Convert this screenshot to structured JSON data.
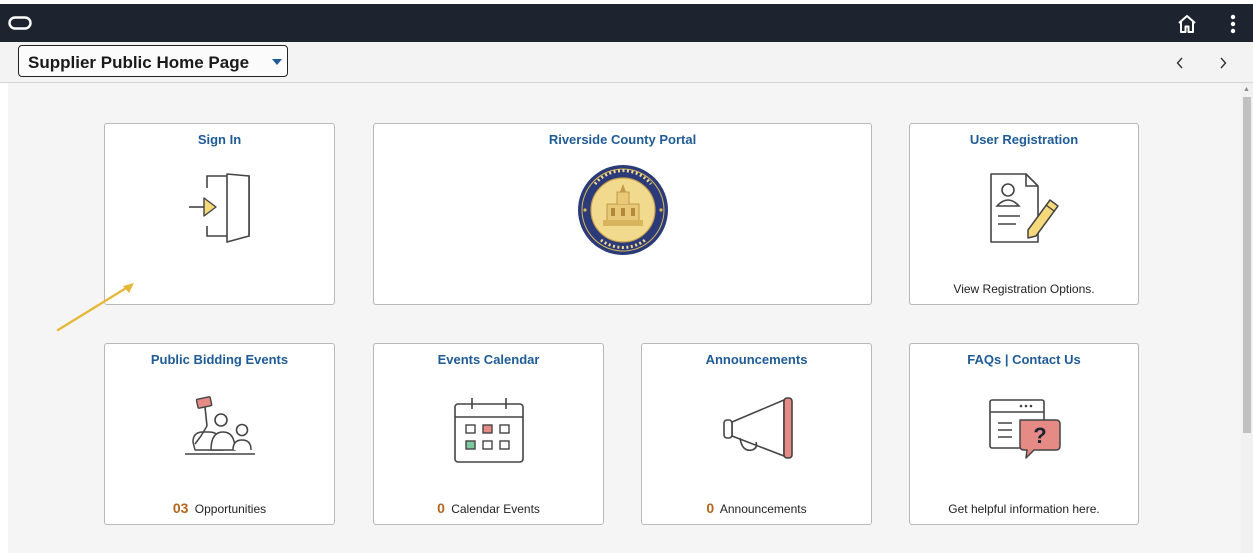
{
  "header": {
    "logo_icon": "oracle-oval-logo-icon",
    "home_icon": "home-icon",
    "menu_icon": "kebab-menu-icon"
  },
  "subheader": {
    "page_title": "Supplier Public Home Page",
    "dropdown_icon": "caret-down-icon",
    "prev_icon": "chevron-left-icon",
    "next_icon": "chevron-right-icon"
  },
  "tiles": {
    "sign_in": {
      "title": "Sign In",
      "icon": "sign-in-door-icon"
    },
    "portal": {
      "title": "Riverside County Portal",
      "icon": "county-seal-icon"
    },
    "registration": {
      "title": "User Registration",
      "footer": "View Registration Options.",
      "icon": "registration-form-icon"
    },
    "bidding": {
      "title": "Public Bidding Events",
      "count": "03",
      "footer": "Opportunities",
      "icon": "bidding-paddle-icon"
    },
    "calendar": {
      "title": "Events Calendar",
      "count": "0",
      "footer": "Calendar Events",
      "icon": "calendar-icon"
    },
    "announcements": {
      "title": "Announcements",
      "count": "0",
      "footer": "Announcements",
      "icon": "megaphone-icon"
    },
    "faqs": {
      "title": "FAQs | Contact Us",
      "footer": "Get helpful information here.",
      "icon": "help-question-icon"
    }
  },
  "colors": {
    "header_bg": "#1d2430",
    "tile_title": "#1f5b96",
    "count": "#b5651d",
    "annotation_arrow": "#e6b83a"
  }
}
